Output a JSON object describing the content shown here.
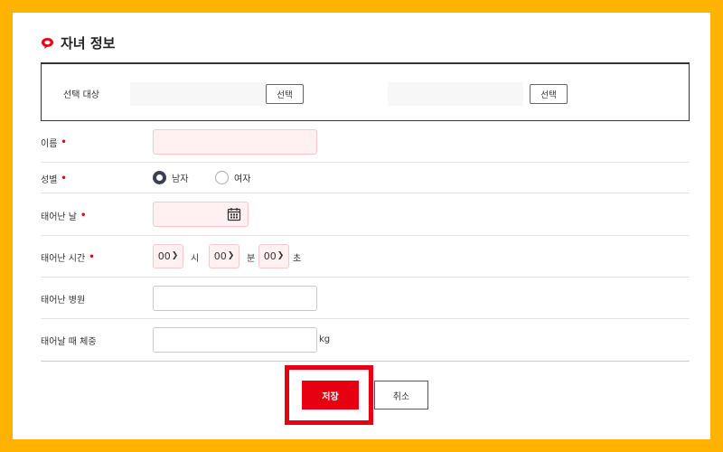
{
  "section": {
    "title": "자녀 정보"
  },
  "target": {
    "label": "선택 대상",
    "select_button_1": "선택",
    "select_button_2": "선택"
  },
  "form": {
    "name": {
      "label": "이름",
      "required_mark": "•"
    },
    "gender": {
      "label": "성별",
      "required_mark": "•",
      "options": [
        "남자",
        "여자"
      ],
      "selected": "남자"
    },
    "birth_date": {
      "label": "태어난 날",
      "required_mark": "•",
      "icon": "calendar-icon"
    },
    "birth_time": {
      "label": "태어난 시간",
      "required_mark": "•",
      "hour": "00",
      "hour_unit": "시",
      "minute": "00",
      "minute_unit": "분",
      "second": "00",
      "second_unit": "초"
    },
    "birth_hospital": {
      "label": "태어난 병원"
    },
    "birth_weight": {
      "label": "태어날 때 체중",
      "unit": "kg"
    }
  },
  "actions": {
    "save_label": "저장",
    "cancel_label": "취소"
  },
  "colors": {
    "frame": "#ffb300",
    "accent": "#e60012",
    "required_input_bg": "#fff1f1",
    "radio_checked": "#3c3f52"
  }
}
